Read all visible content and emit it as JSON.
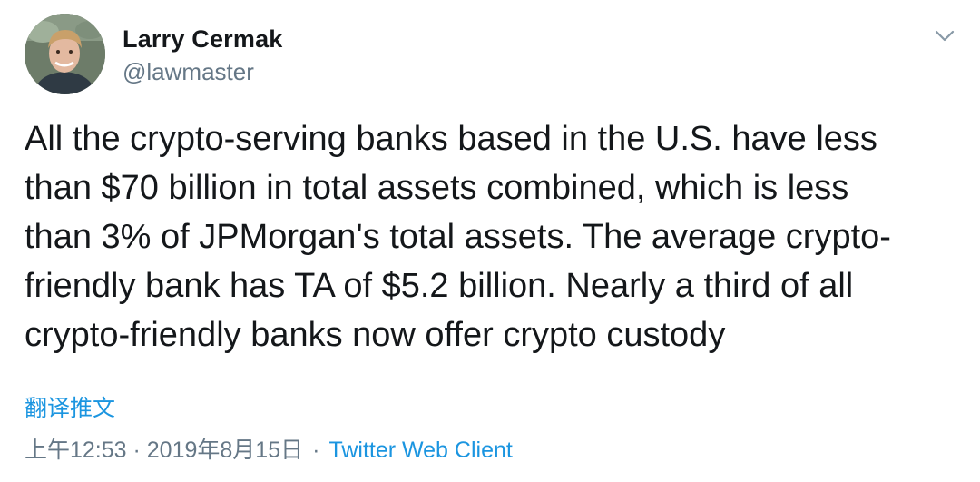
{
  "tweet": {
    "author_name": "Larry Cermak",
    "author_handle": "@lawmaster",
    "text": "All the crypto-serving banks based in the U.S. have less\nthan $70 billion in total assets combined, which is less\nthan 3% of JPMorgan's total assets. The average crypto-\nfriendly bank has TA of $5.2 billion. Nearly a third of all\ncrypto-friendly banks now offer crypto custody",
    "translate_label": "翻译推文",
    "timestamp": "上午12:53 · 2019年8月15日",
    "separator": "·",
    "source": "Twitter Web Client",
    "menu_icon": "chevron-down-icon"
  },
  "colors": {
    "text": "#14171a",
    "secondary": "#657786",
    "link": "#1b95e0"
  }
}
